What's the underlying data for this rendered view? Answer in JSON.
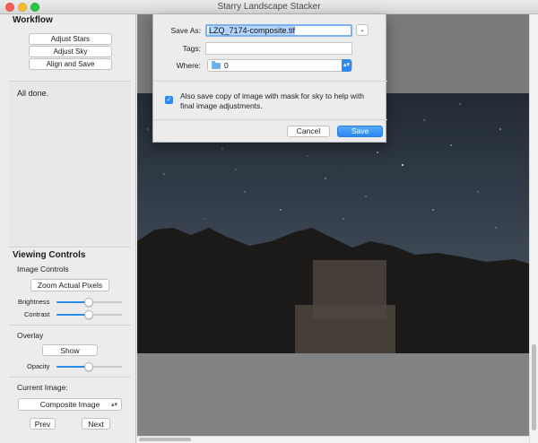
{
  "window": {
    "title": "Starry Landscape Stacker"
  },
  "workflow": {
    "title": "Workflow",
    "buttons": [
      "Adjust Stars",
      "Adjust Sky",
      "Align and Save"
    ],
    "log": "All done."
  },
  "viewing": {
    "title": "Viewing Controls",
    "image_controls_label": "Image Controls",
    "zoom_button": "Zoom Actual Pixels",
    "brightness_label": "Brightness",
    "brightness_value": 0.5,
    "contrast_label": "Contrast",
    "contrast_value": 0.5,
    "overlay_label": "Overlay",
    "show_button": "Show",
    "opacity_label": "Opacity",
    "opacity_value": 0.5,
    "current_image_label": "Current Image:",
    "current_image_value": "Composite Image",
    "prev_button": "Prev",
    "next_button": "Next"
  },
  "save_dialog": {
    "save_as_label": "Save As:",
    "filename": "LZQ_7174-composite.tif",
    "tags_label": "Tags:",
    "tags_value": "",
    "where_label": "Where:",
    "where_value": "0",
    "checkbox_checked": true,
    "checkbox_text": "Also save copy of image with mask for sky to help with final image adjustments.",
    "cancel_label": "Cancel",
    "save_label": "Save"
  },
  "colors": {
    "accent": "#2a8cf0",
    "selection": "#b4d5fe"
  }
}
